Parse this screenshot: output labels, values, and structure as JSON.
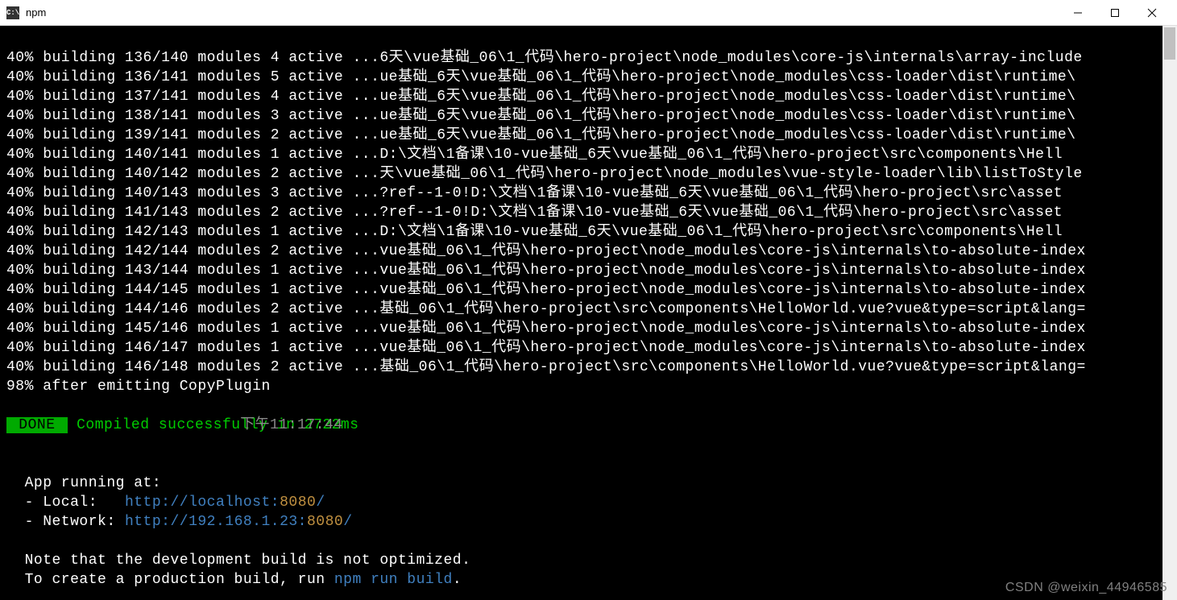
{
  "titlebar": {
    "title": "npm",
    "icon_label": "C:\\"
  },
  "build_lines": [
    "40% building 136/140 modules 4 active ...6天\\vue基础_06\\1_代码\\hero-project\\node_modules\\core-js\\internals\\array-include",
    "40% building 136/141 modules 5 active ...ue基础_6天\\vue基础_06\\1_代码\\hero-project\\node_modules\\css-loader\\dist\\runtime\\",
    "40% building 137/141 modules 4 active ...ue基础_6天\\vue基础_06\\1_代码\\hero-project\\node_modules\\css-loader\\dist\\runtime\\",
    "40% building 138/141 modules 3 active ...ue基础_6天\\vue基础_06\\1_代码\\hero-project\\node_modules\\css-loader\\dist\\runtime\\",
    "40% building 139/141 modules 2 active ...ue基础_6天\\vue基础_06\\1_代码\\hero-project\\node_modules\\css-loader\\dist\\runtime\\",
    "40% building 140/141 modules 1 active ...D:\\文档\\1备课\\10-vue基础_6天\\vue基础_06\\1_代码\\hero-project\\src\\components\\Hell",
    "40% building 140/142 modules 2 active ...天\\vue基础_06\\1_代码\\hero-project\\node_modules\\vue-style-loader\\lib\\listToStyle",
    "40% building 140/143 modules 3 active ...?ref--1-0!D:\\文档\\1备课\\10-vue基础_6天\\vue基础_06\\1_代码\\hero-project\\src\\asset",
    "40% building 141/143 modules 2 active ...?ref--1-0!D:\\文档\\1备课\\10-vue基础_6天\\vue基础_06\\1_代码\\hero-project\\src\\asset",
    "40% building 142/143 modules 1 active ...D:\\文档\\1备课\\10-vue基础_6天\\vue基础_06\\1_代码\\hero-project\\src\\components\\Hell",
    "40% building 142/144 modules 2 active ...vue基础_06\\1_代码\\hero-project\\node_modules\\core-js\\internals\\to-absolute-index",
    "40% building 143/144 modules 1 active ...vue基础_06\\1_代码\\hero-project\\node_modules\\core-js\\internals\\to-absolute-index",
    "40% building 144/145 modules 1 active ...vue基础_06\\1_代码\\hero-project\\node_modules\\core-js\\internals\\to-absolute-index",
    "40% building 144/146 modules 2 active ...基础_06\\1_代码\\hero-project\\src\\components\\HelloWorld.vue?vue&type=script&lang=",
    "40% building 145/146 modules 1 active ...vue基础_06\\1_代码\\hero-project\\node_modules\\core-js\\internals\\to-absolute-index",
    "40% building 146/147 modules 1 active ...vue基础_06\\1_代码\\hero-project\\node_modules\\core-js\\internals\\to-absolute-index",
    "40% building 146/148 modules 2 active ...基础_06\\1_代码\\hero-project\\src\\components\\HelloWorld.vue?vue&type=script&lang=",
    "98% after emitting CopyPlugin"
  ],
  "status": {
    "done_label": " DONE ",
    "success_msg": "Compiled successfully in 2722ms",
    "timestamp": "下午11:17:44"
  },
  "app_info": {
    "heading": "  App running at:",
    "local_label": "  - Local:   ",
    "local_url_prefix": "http://",
    "local_url_host": "localhost:",
    "local_url_port": "8080",
    "local_url_suffix": "/",
    "network_label": "  - Network: ",
    "network_url_prefix": "http://",
    "network_url_host": "192.168.1.23:",
    "network_url_port": "8080",
    "network_url_suffix": "/"
  },
  "note": {
    "line1": "  Note that the development build is not optimized.",
    "line2_prefix": "  To create a production build, run ",
    "line2_cmd": "npm run build",
    "line2_suffix": "."
  },
  "watermark": "CSDN @weixin_44946585"
}
